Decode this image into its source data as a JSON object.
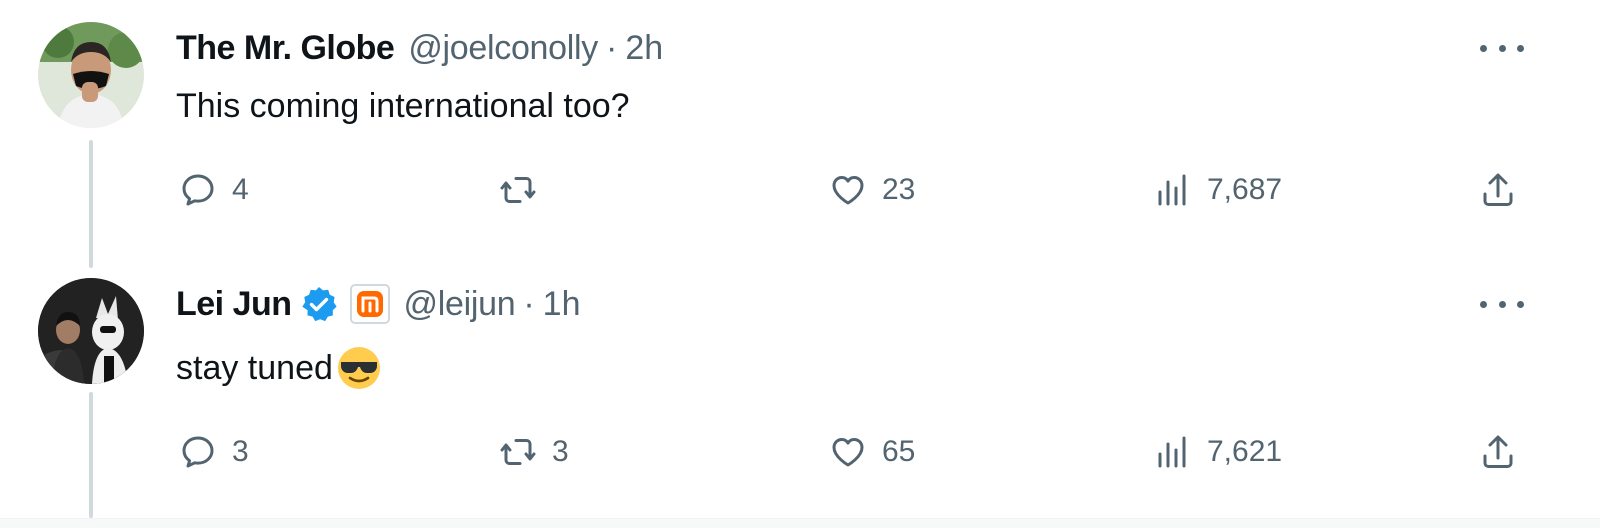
{
  "tweets": [
    {
      "display_name": "The Mr. Globe",
      "handle": "@joelconolly",
      "separator": "·",
      "time": "2h",
      "text": "This coming international too?",
      "avatar_icon": "person-with-mask-avatar",
      "verified": false,
      "stats": {
        "replies": "4",
        "retweets": "",
        "likes": "23",
        "views": "7,687"
      }
    },
    {
      "display_name": "Lei Jun",
      "handle": "@leijun",
      "separator": "·",
      "time": "1h",
      "text": "stay tuned",
      "emoji": "smiling-face-with-sunglasses-emoji",
      "avatar_icon": "person-with-robot-avatar",
      "verified": true,
      "affiliation_icon": "xiaomi-logo-icon",
      "stats": {
        "replies": "3",
        "retweets": "3",
        "likes": "65",
        "views": "7,621"
      }
    }
  ],
  "colors": {
    "text_primary": "#0f1419",
    "text_secondary": "#536471",
    "verified_blue": "#1d9bf0",
    "brand_orange": "#ff6900",
    "thread_line": "#cfd9de"
  },
  "icons": {
    "reply": "reply-icon",
    "retweet": "retweet-icon",
    "like": "heart-icon",
    "views": "views-chart-icon",
    "share": "share-icon",
    "more": "more-options-icon"
  }
}
